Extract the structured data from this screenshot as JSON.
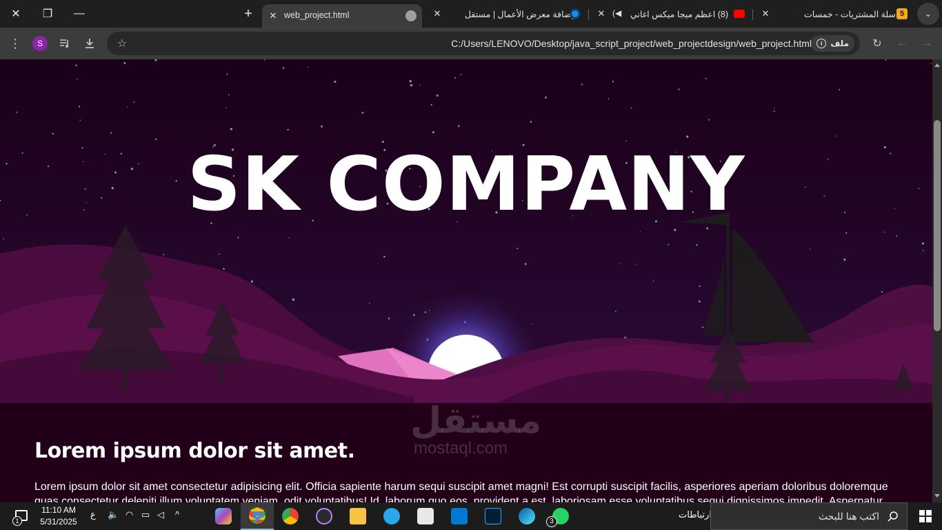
{
  "browser": {
    "tabs": [
      {
        "title": "سلة المشتريات - خمسات",
        "favicon_color": "#f5a623",
        "favicon_text": "5"
      },
      {
        "title": "(8) اعظم ميجا ميكس اغاني لـ",
        "favicon_color": "#ff0000"
      },
      {
        "title": "إضافة معرض الأعمال | مستقل",
        "favicon_color": "#1e88e5"
      },
      {
        "title": "web_project.html",
        "active": true
      }
    ],
    "url": "C:/Users/LENOVO/Desktop/java_script_project/web_projectdesign/web_project.html",
    "site_chip": "ملف",
    "profile_initial": "S",
    "accent": "#8e24aa"
  },
  "page": {
    "hero_title": "SK COMPANY",
    "section_heading": "Lorem ipsum dolor sit amet.",
    "section_text": "Lorem ipsum dolor sit amet consectetur adipisicing elit. Officia sapiente harum sequi suscipit amet magni! Est corrupti suscipit facilis, asperiores aperiam doloribus doloremque quas consectetur deleniti illum voluptatem veniam, odit voluptatibus! Id, laborum quo eos, provident a est, laboriosam esse voluptatibus sequi dignissimos impedit. Aspernatur",
    "watermark": "مستقل",
    "watermark_url": "mostaql.com",
    "colors": {
      "background": "#220019",
      "hills": "#5a0f4a",
      "moon": "#ffffff"
    }
  },
  "taskbar": {
    "search_placeholder": "اكتب هنا للبحث",
    "links_label": "ارتباطات",
    "time": "11:10 AM",
    "date": "5/31/2025",
    "lang": "ع",
    "notification_count": "1",
    "whatsapp_badge": "3"
  }
}
